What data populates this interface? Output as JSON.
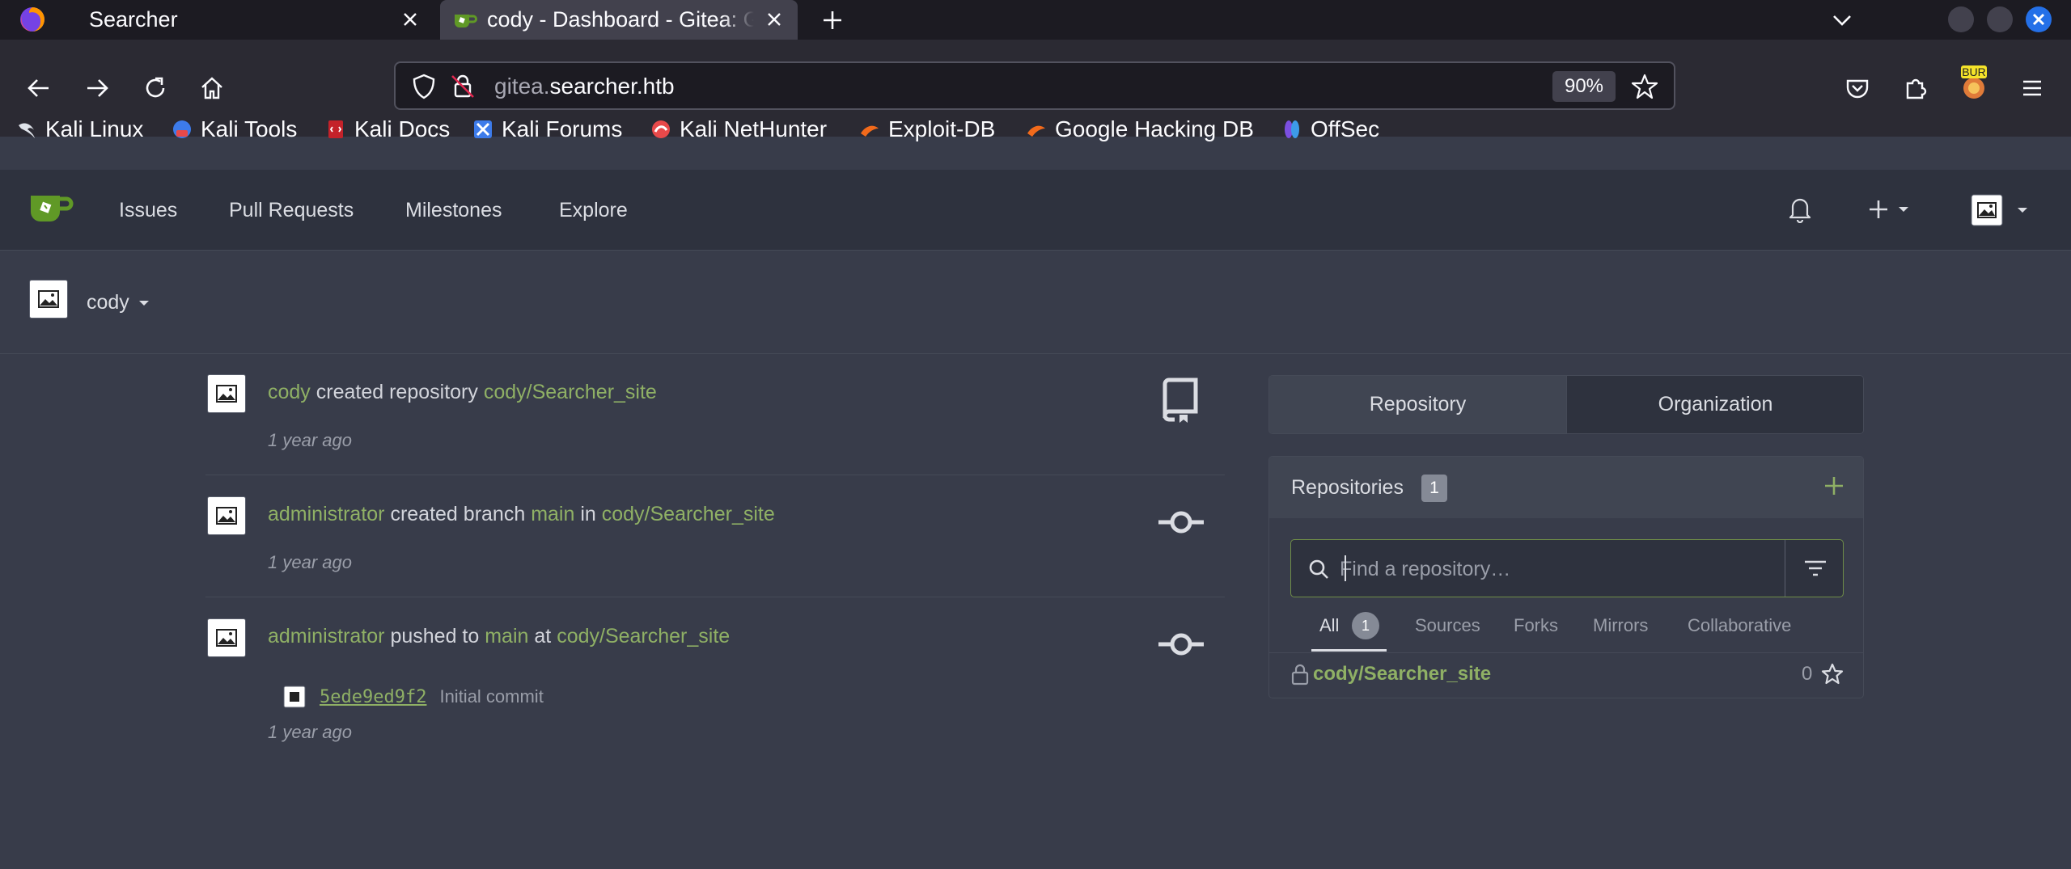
{
  "browser": {
    "tabs": [
      {
        "title": "Searcher"
      },
      {
        "title": "cody - Dashboard - Gitea: Git with a cup of tea"
      }
    ],
    "url_prefix": "gitea.",
    "url_domain": "searcher.htb",
    "zoom": "90%",
    "bookmarks": [
      {
        "label": "Kali Linux",
        "icon": "kali-icon"
      },
      {
        "label": "Kali Tools",
        "icon": "kali-tools-icon"
      },
      {
        "label": "Kali Docs",
        "icon": "kali-docs-icon"
      },
      {
        "label": "Kali Forums",
        "icon": "kali-forums-icon"
      },
      {
        "label": "Kali NetHunter",
        "icon": "nethunter-icon"
      },
      {
        "label": "Exploit-DB",
        "icon": "exploit-db-icon"
      },
      {
        "label": "Google Hacking DB",
        "icon": "ghdb-icon"
      },
      {
        "label": "OffSec",
        "icon": "offsec-icon"
      }
    ],
    "extension_badge": "BUR"
  },
  "gitea": {
    "nav": {
      "items": [
        "Issues",
        "Pull Requests",
        "Milestones",
        "Explore"
      ]
    },
    "context_user": "cody",
    "feed": [
      {
        "actor": "cody",
        "action": "created repository",
        "target": "cody/Searcher_site",
        "time": "1 year ago",
        "icon": "repo-icon"
      },
      {
        "actor": "administrator",
        "action": "created branch",
        "branch": "main",
        "in_word": "in",
        "target": "cody/Searcher_site",
        "time": "1 year ago",
        "icon": "commit-icon"
      },
      {
        "actor": "administrator",
        "action": "pushed to",
        "branch": "main",
        "at_word": "at",
        "target": "cody/Searcher_site",
        "commit_sha": "5ede9ed9f2",
        "commit_message": "Initial commit",
        "time": "1 year ago",
        "icon": "commit-icon"
      }
    ],
    "switcher": {
      "repository": "Repository",
      "organization": "Organization"
    },
    "repos": {
      "title": "Repositories",
      "count": "1",
      "search_placeholder": "Find a repository…",
      "tabs": [
        {
          "label": "All",
          "count": "1"
        },
        {
          "label": "Sources"
        },
        {
          "label": "Forks"
        },
        {
          "label": "Mirrors"
        },
        {
          "label": "Collaborative"
        }
      ],
      "list": [
        {
          "name": "cody/Searcher_site",
          "stars": "0"
        }
      ]
    }
  },
  "colors": {
    "accent_green": "#8fb065",
    "page_bg": "#383c4a",
    "header_bg": "#2e323e",
    "browser_tabbar": "#1c1b22",
    "browser_toolbar": "#2b2a33"
  }
}
